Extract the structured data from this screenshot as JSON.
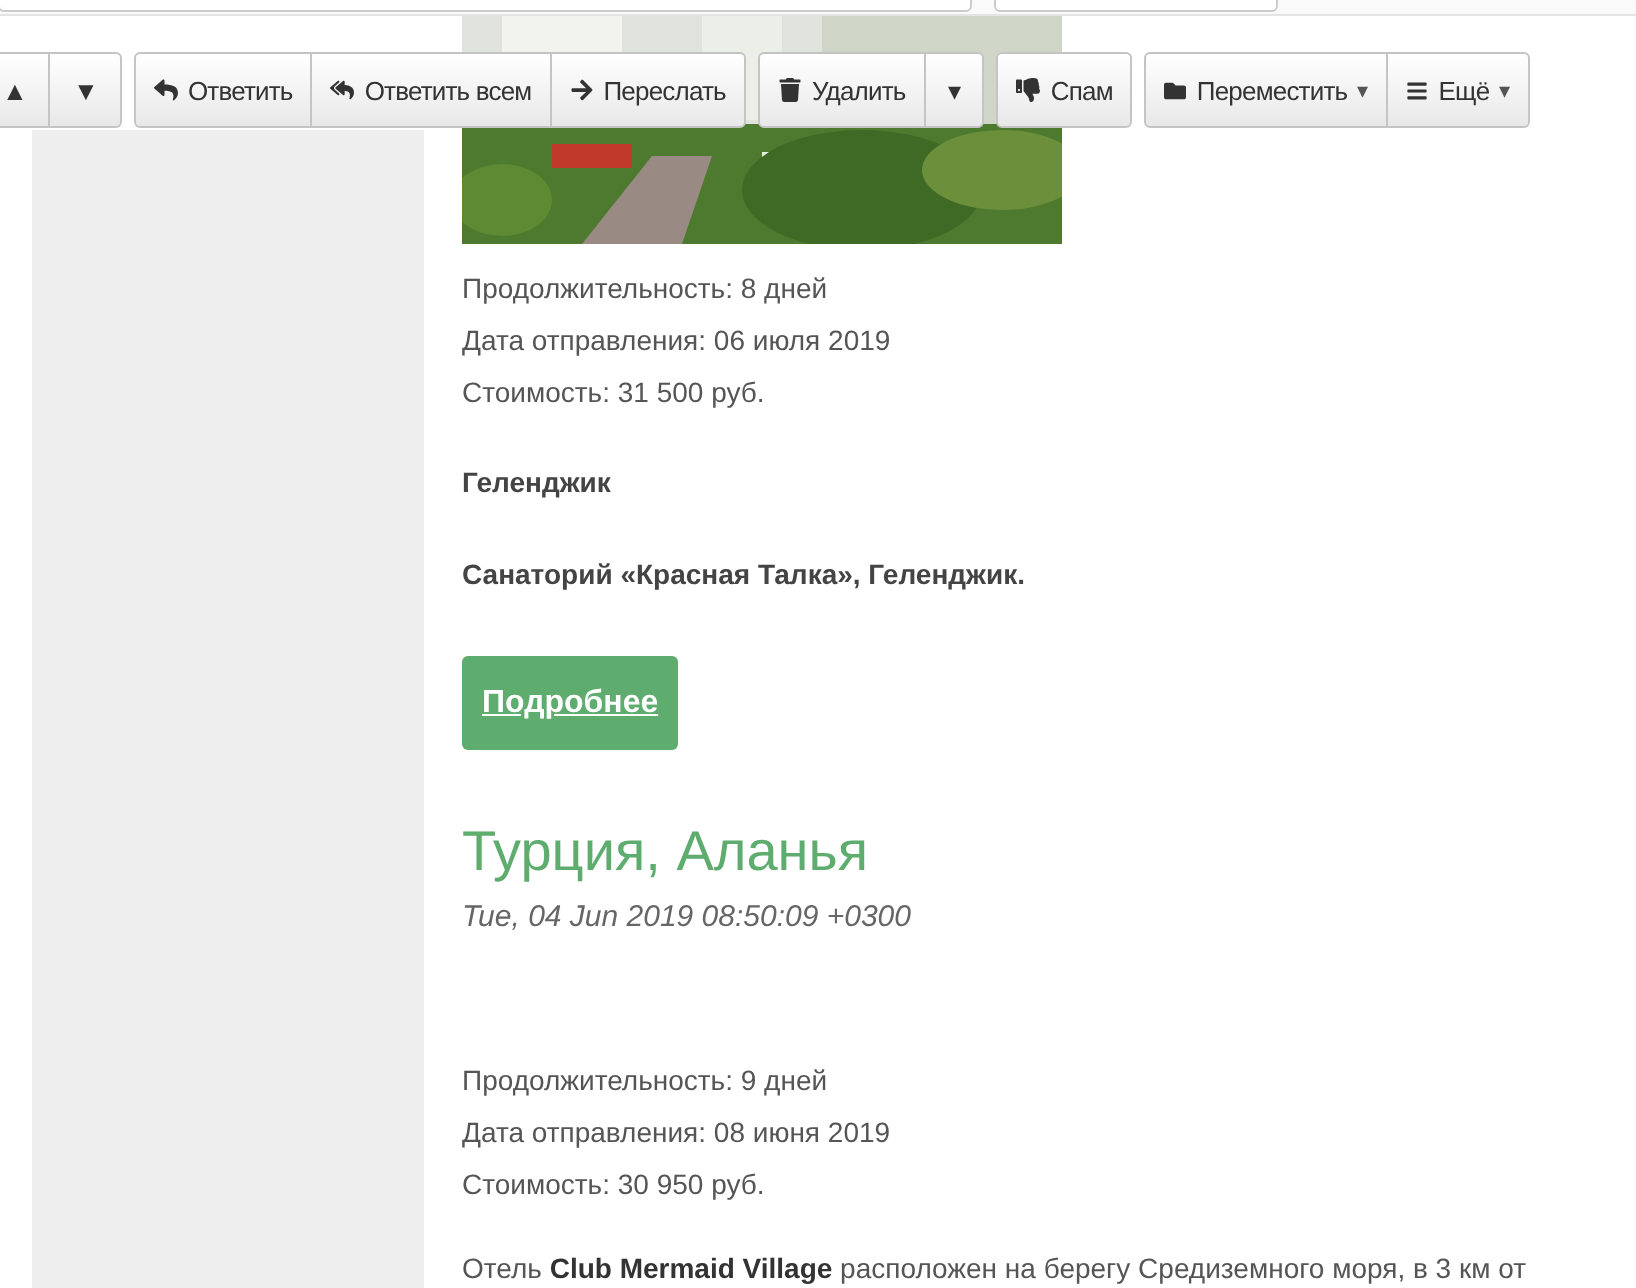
{
  "toolbar": {
    "groups": [
      {
        "buttons": [
          {
            "label": "▲"
          },
          {
            "label": "▼"
          }
        ]
      },
      {
        "buttons": [
          {
            "label": "Ответить"
          },
          {
            "label": "Ответить всем"
          },
          {
            "label": "Переслать"
          }
        ]
      },
      {
        "buttons": [
          {
            "label": "Удалить"
          },
          {
            "label": "▾"
          }
        ]
      },
      {
        "buttons": [
          {
            "label": "Спам"
          }
        ]
      },
      {
        "buttons": [
          {
            "label": "Переместить",
            "caret": "▾"
          },
          {
            "label": "Ещё",
            "caret": "▾"
          }
        ]
      }
    ]
  },
  "message": {
    "blocks": [
      {
        "kind": "picture"
      },
      {
        "kind": "details",
        "lines": [
          "Продолжительность: 8 дней",
          "Дата отправления: 06 июля 2019",
          "Стоимость: 31 500 руб."
        ]
      },
      {
        "kind": "bold",
        "text": "Геленджик"
      },
      {
        "kind": "bold",
        "text": "Санаторий «Красная Талка», Геленджик."
      },
      {
        "kind": "button",
        "text": "Подробнее"
      },
      {
        "kind": "title",
        "text": "Турция, Аланья"
      },
      {
        "kind": "date",
        "text": "Tue, 04 Jun 2019 08:50:09 +0300"
      },
      {
        "kind": "details",
        "lines": [
          "Продолжительность: 9 дней",
          "Дата отправления: 08 июня 2019",
          "Стоимость: 30 950 руб."
        ]
      },
      {
        "kind": "paragraph",
        "text": "Отель **Club Mermaid Village** расположен на берегу Средиземного моря, в 3 км от"
      }
    ]
  }
}
